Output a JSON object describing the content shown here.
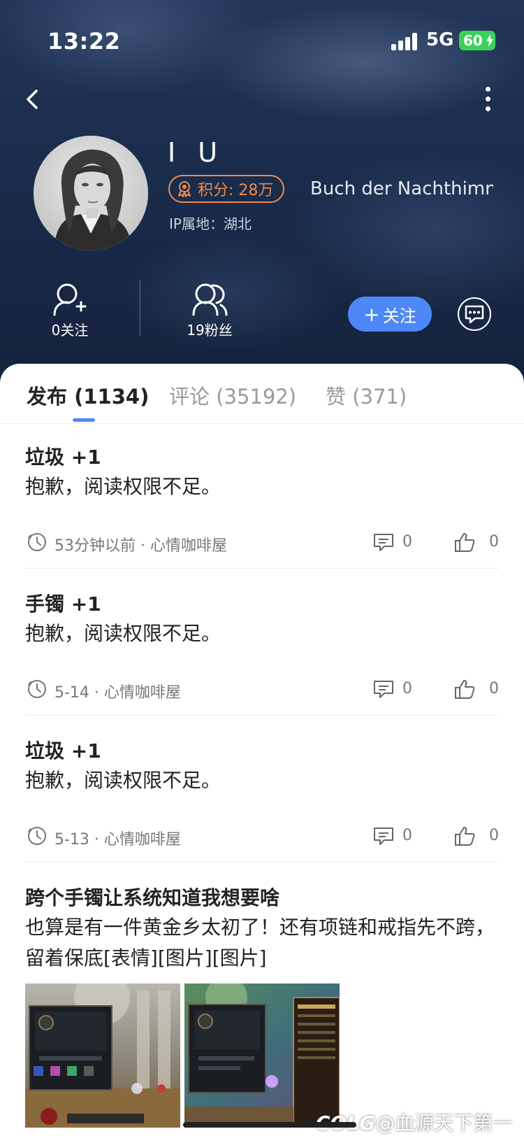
{
  "status_bar": {
    "time": "13:22",
    "network": "5G",
    "battery": "60"
  },
  "profile": {
    "username": "I U",
    "points_label": "积分: 28万",
    "title_text": "Buch der Nachthimn",
    "ip_location": "IP属地：湖北",
    "following_label": "0关注",
    "fans_label": "19粉丝",
    "follow_button": "关注",
    "follow_plus": "+"
  },
  "tabs": [
    {
      "label": "发布 (1134)",
      "active": true
    },
    {
      "label": "评论 (35192)",
      "active": false
    },
    {
      "label": "赞 (371)",
      "active": false
    }
  ],
  "posts": [
    {
      "title": "垃圾 +1",
      "body": "抱歉，阅读权限不足。",
      "meta": "53分钟以前 · 心情咖啡屋",
      "comments": "0",
      "likes": "0"
    },
    {
      "title": "手镯 +1",
      "body": "抱歉，阅读权限不足。",
      "meta": "5-14 · 心情咖啡屋",
      "comments": "0",
      "likes": "0"
    },
    {
      "title": "垃圾 +1",
      "body": "抱歉，阅读权限不足。",
      "meta": "5-13 · 心情咖啡屋",
      "comments": "0",
      "likes": "0"
    },
    {
      "title": "跨个手镯让系统知道我想要啥",
      "body": "也算是有一件黄金乡太初了！还有项链和戒指先不跨，留着保底[表情][图片][图片]"
    }
  ],
  "watermark": "@血源天下第一",
  "watermark_logo": "COLG",
  "colors": {
    "accent": "#4d88f6",
    "badge": "#f08a4b",
    "header_bg": "#1b2d4d"
  },
  "icons": [
    "back-arrow-icon",
    "more-vertical-icon",
    "medal-icon",
    "following-icon",
    "fans-icon",
    "chat-bubble-icon",
    "clock-icon",
    "comment-icon",
    "thumbs-up-icon"
  ]
}
